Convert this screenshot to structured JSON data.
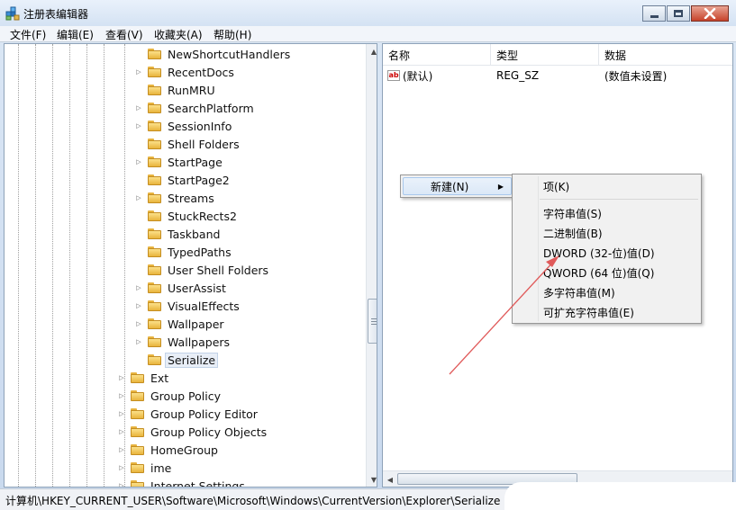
{
  "window": {
    "title": "注册表编辑器",
    "minimize_icon": "minimize-icon",
    "maximize_icon": "maximize-icon",
    "close_icon": "close-icon"
  },
  "menubar": [
    "文件(F)",
    "编辑(E)",
    "查看(V)",
    "收藏夹(A)",
    "帮助(H)"
  ],
  "tree": {
    "items": [
      {
        "label": "NewShortcutHandlers",
        "expander": false
      },
      {
        "label": "RecentDocs",
        "expander": true
      },
      {
        "label": "RunMRU",
        "expander": false
      },
      {
        "label": "SearchPlatform",
        "expander": true
      },
      {
        "label": "SessionInfo",
        "expander": true
      },
      {
        "label": "Shell Folders",
        "expander": false
      },
      {
        "label": "StartPage",
        "expander": true
      },
      {
        "label": "StartPage2",
        "expander": false
      },
      {
        "label": "Streams",
        "expander": true
      },
      {
        "label": "StuckRects2",
        "expander": false
      },
      {
        "label": "Taskband",
        "expander": false
      },
      {
        "label": "TypedPaths",
        "expander": false
      },
      {
        "label": "User Shell Folders",
        "expander": false
      },
      {
        "label": "UserAssist",
        "expander": true
      },
      {
        "label": "VisualEffects",
        "expander": true
      },
      {
        "label": "Wallpaper",
        "expander": true
      },
      {
        "label": "Wallpapers",
        "expander": true
      },
      {
        "label": "Serialize",
        "expander": false,
        "selected": true
      },
      {
        "label": "Ext",
        "expander": true,
        "level": 0
      },
      {
        "label": "Group Policy",
        "expander": true,
        "level": 0
      },
      {
        "label": "Group Policy Editor",
        "expander": true,
        "level": 0
      },
      {
        "label": "Group Policy Objects",
        "expander": true,
        "level": 0
      },
      {
        "label": "HomeGroup",
        "expander": true,
        "level": 0
      },
      {
        "label": "ime",
        "expander": true,
        "level": 0
      },
      {
        "label": "Internet Settings",
        "expander": true,
        "level": 0
      }
    ]
  },
  "list": {
    "columns": [
      "名称",
      "类型",
      "数据"
    ],
    "rows": [
      {
        "name": "(默认)",
        "type": "REG_SZ",
        "data": "(数值未设置)"
      }
    ]
  },
  "context_menu": {
    "new_label": "新建(N)",
    "submenu": {
      "key": "项(K)",
      "string_value": "字符串值(S)",
      "binary_value": "二进制值(B)",
      "dword_value": "DWORD (32-位)值(D)",
      "qword_value": "QWORD (64 位)值(Q)",
      "multi_string_value": "多字符串值(M)",
      "expandable_string_value": "可扩充字符串值(E)"
    }
  },
  "status": {
    "path": "计算机\\HKEY_CURRENT_USER\\Software\\Microsoft\\Windows\\CurrentVersion\\Explorer\\Serialize"
  },
  "colors": {
    "annotation_arrow": "#e05a5a",
    "folder": "#f3c75a",
    "hover": "#dbe8f7"
  }
}
